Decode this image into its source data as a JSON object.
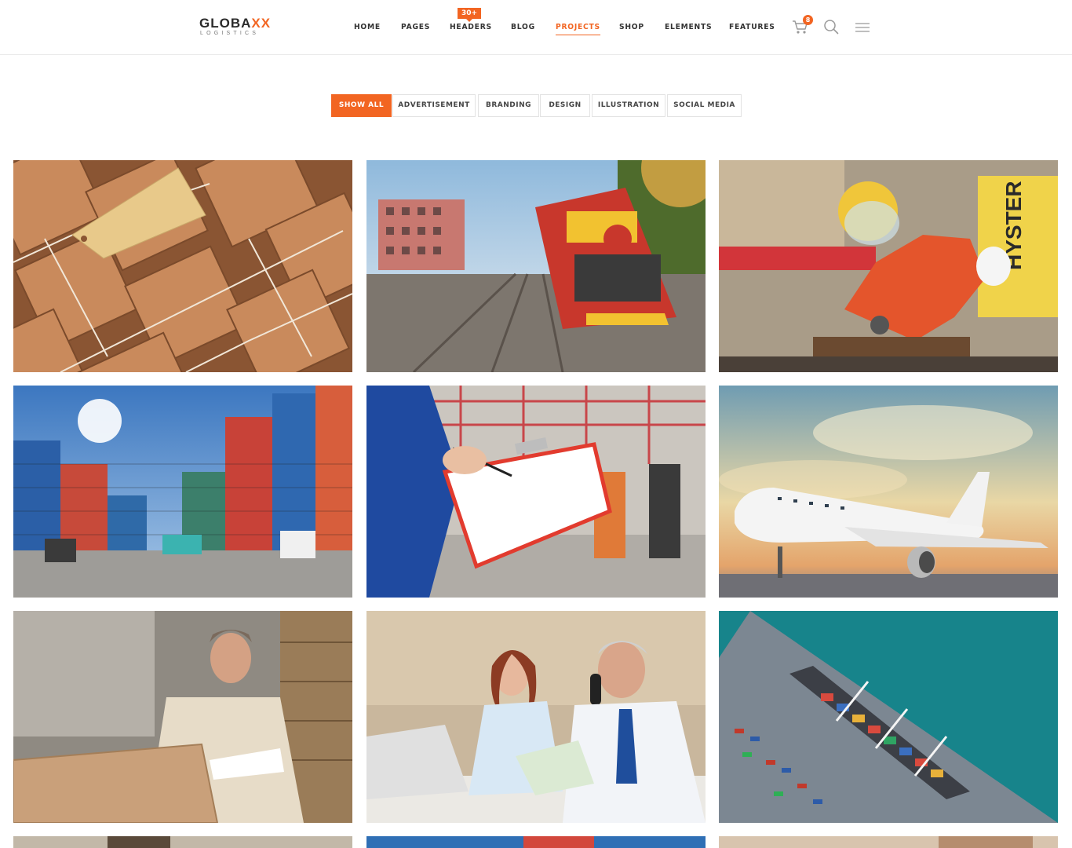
{
  "brand": {
    "name_main": "GLOBA",
    "name_accent": "XX",
    "tagline": "LOGISTICS"
  },
  "nav": {
    "items": [
      {
        "label": "HOME"
      },
      {
        "label": "PAGES"
      },
      {
        "label": "HEADERS",
        "badge": "30+"
      },
      {
        "label": "BLOG"
      },
      {
        "label": "PROJECTS",
        "active": true
      },
      {
        "label": "SHOP"
      },
      {
        "label": "ELEMENTS"
      },
      {
        "label": "FEATURES"
      }
    ],
    "cart_count": "8"
  },
  "filters": [
    {
      "label": "SHOW ALL",
      "active": true
    },
    {
      "label": "ADVERTISEMENT"
    },
    {
      "label": "BRANDING"
    },
    {
      "label": "DESIGN"
    },
    {
      "label": "ILLUSTRATION"
    },
    {
      "label": "SOCIAL MEDIA"
    }
  ],
  "colors": {
    "accent": "#f26522",
    "text": "#333333",
    "border": "#e3e3e3"
  },
  "projects": [
    {
      "image": "kraft-paper-parcels-with-tag"
    },
    {
      "image": "freight-train-on-tracks"
    },
    {
      "image": "worker-with-angle-grinder"
    },
    {
      "image": "shipping-container-yard-forklift"
    },
    {
      "image": "warehouse-clipboard-inspection"
    },
    {
      "image": "cargo-airplane-at-sunset"
    },
    {
      "image": "warehouse-manager-with-boxes"
    },
    {
      "image": "office-workers-on-phone"
    },
    {
      "image": "aerial-container-ship-at-port"
    },
    {
      "image": "partial-row-tile-1"
    },
    {
      "image": "partial-row-tile-2"
    },
    {
      "image": "partial-row-tile-3"
    }
  ],
  "icons": {
    "cart": "cart-icon",
    "search": "search-icon",
    "menu": "hamburger-menu-icon"
  }
}
